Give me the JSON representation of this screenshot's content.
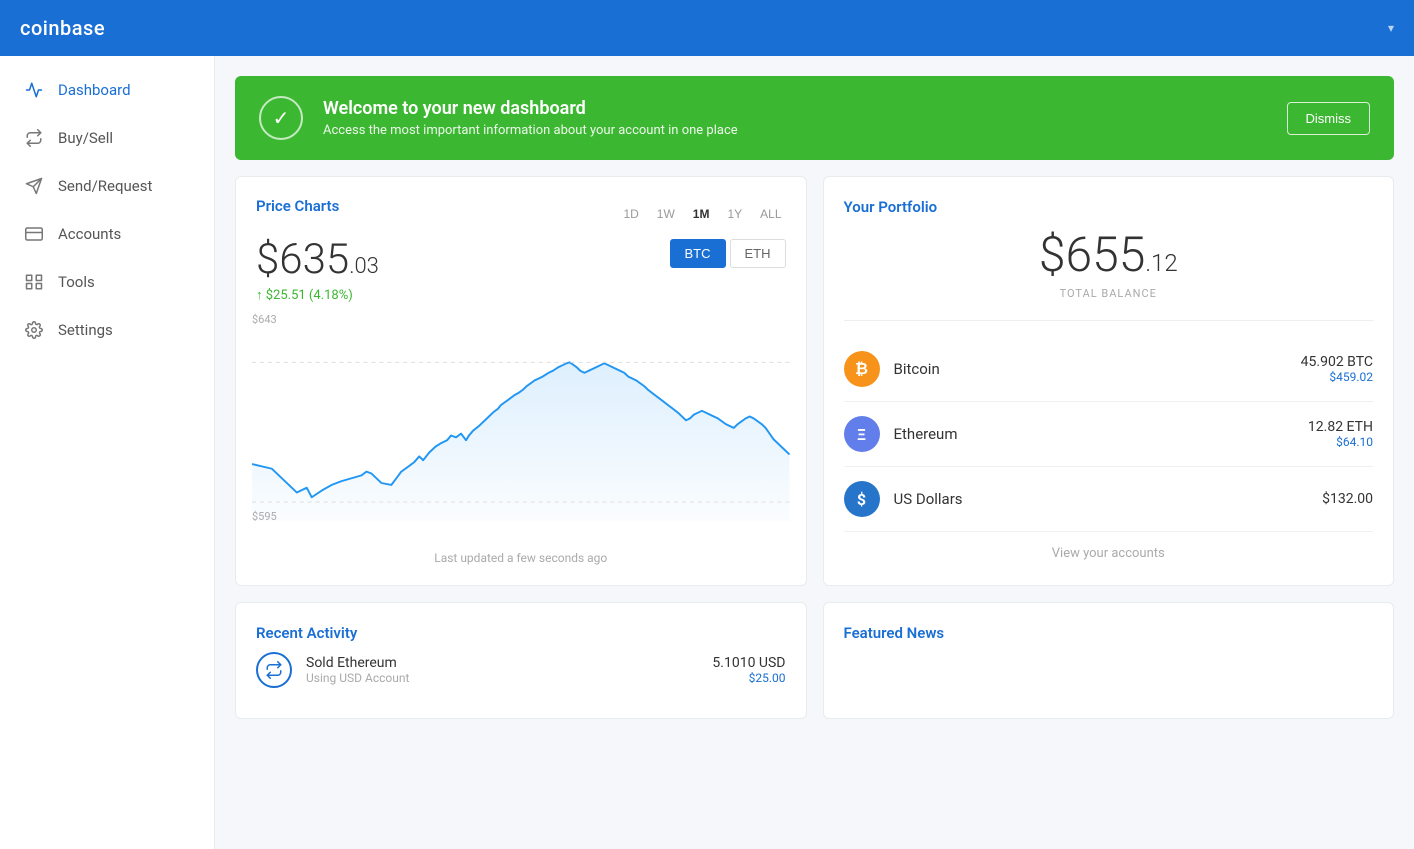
{
  "header": {
    "logo": "coinbase",
    "chevron": "▾"
  },
  "sidebar": {
    "items": [
      {
        "id": "dashboard",
        "label": "Dashboard",
        "active": true,
        "icon": "activity"
      },
      {
        "id": "buysell",
        "label": "Buy/Sell",
        "active": false,
        "icon": "refresh"
      },
      {
        "id": "sendrequest",
        "label": "Send/Request",
        "active": false,
        "icon": "send"
      },
      {
        "id": "accounts",
        "label": "Accounts",
        "active": false,
        "icon": "credit-card"
      },
      {
        "id": "tools",
        "label": "Tools",
        "active": false,
        "icon": "tools"
      },
      {
        "id": "settings",
        "label": "Settings",
        "active": false,
        "icon": "settings"
      }
    ]
  },
  "welcome": {
    "title": "Welcome to your new dashboard",
    "subtitle": "Access the most important information about your account in one place",
    "dismiss_label": "Dismiss"
  },
  "price_charts": {
    "title": "Price Charts",
    "time_filters": [
      "1D",
      "1W",
      "1M",
      "1Y",
      "ALL"
    ],
    "active_filter": "1M",
    "price_dollars": "$635",
    "price_cents": ".03",
    "change": "↑ $25.51 (4.18%)",
    "currencies": [
      "BTC",
      "ETH"
    ],
    "active_currency": "BTC",
    "chart_high": "$643",
    "chart_low": "$595",
    "last_updated": "Last updated a few seconds ago"
  },
  "portfolio": {
    "title": "Your Portfolio",
    "total_balance": "$655",
    "total_cents": ".12",
    "total_label": "TOTAL BALANCE",
    "assets": [
      {
        "id": "btc",
        "name": "Bitcoin",
        "primary": "45.902 BTC",
        "secondary": "$459.02"
      },
      {
        "id": "eth",
        "name": "Ethereum",
        "primary": "12.82 ETH",
        "secondary": "$64.10"
      },
      {
        "id": "usd",
        "name": "US Dollars",
        "primary": "$132.00",
        "secondary": ""
      }
    ],
    "view_accounts_label": "View your accounts"
  },
  "recent_activity": {
    "title": "Recent Activity",
    "items": [
      {
        "action": "Sold Ethereum",
        "sub": "Using USD Account",
        "primary": "5.1010 USD",
        "secondary": "$25.00"
      }
    ]
  },
  "featured_news": {
    "title": "Featured News"
  }
}
